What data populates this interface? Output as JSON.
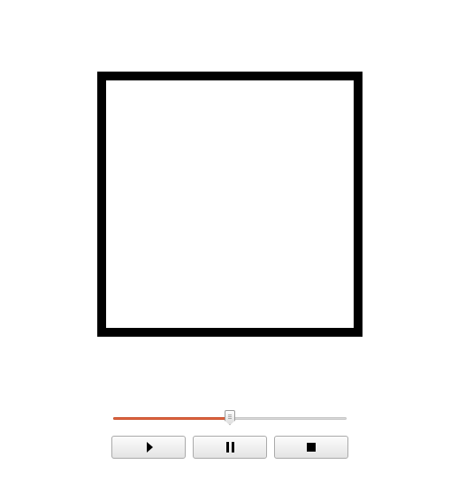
{
  "player": {
    "progress_fraction": 0.5,
    "accent_color": "#e0623f",
    "buttons": {
      "play_icon": "play-icon",
      "pause_icon": "pause-icon",
      "stop_icon": "stop-icon"
    }
  }
}
